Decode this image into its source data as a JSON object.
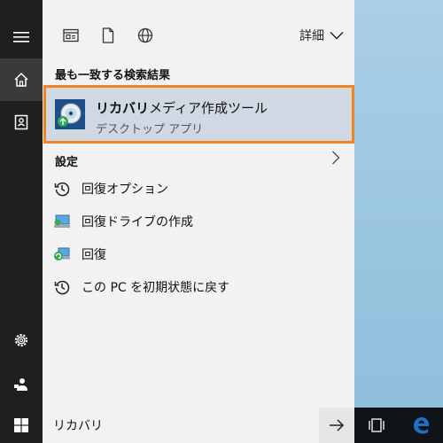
{
  "topbar": {
    "detail_label": "詳細"
  },
  "best_match": {
    "heading": "最も一致する検索結果",
    "title_bold": "リカバリ",
    "title_rest": "メディア作成ツール",
    "subtitle": "デスクトップ アプリ"
  },
  "settings": {
    "heading": "設定",
    "items": [
      {
        "label": "回復オプション",
        "icon": "history-icon"
      },
      {
        "label": "回復ドライブの作成",
        "icon": "computer-icon"
      },
      {
        "label": "回復",
        "icon": "recovery-icon"
      },
      {
        "label": "この PC を初期状態に戻す",
        "icon": "history-icon"
      }
    ]
  },
  "search": {
    "value": "リカバリ"
  },
  "colors": {
    "highlight_border": "#f0861f",
    "highlight_bg": "#cfd8e3",
    "edge_blue": "#1a73c8"
  }
}
